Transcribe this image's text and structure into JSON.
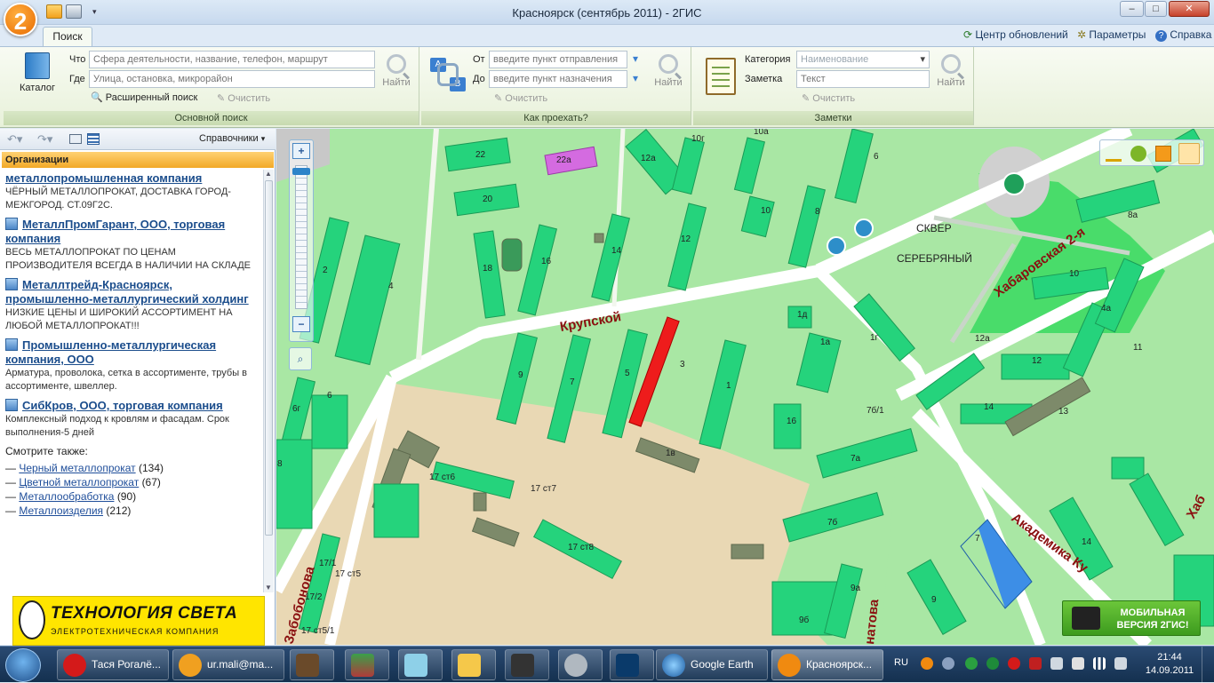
{
  "window": {
    "title": "Красноярск (сентябрь 2011) - 2ГИС",
    "logo_glyph": "2",
    "minimize": "–",
    "maximize": "□",
    "close": "✕"
  },
  "tabs": {
    "search": "Поиск"
  },
  "top_links": {
    "updates": "Центр обновлений",
    "settings": "Параметры",
    "help": "Справка"
  },
  "ribbon": {
    "main": {
      "catalog": "Каталог",
      "what_label": "Что",
      "what_placeholder": "Сфера деятельности, название, телефон, маршрут",
      "where_label": "Где",
      "where_placeholder": "Улица, остановка, микрорайон",
      "find": "Найти",
      "advanced": "Расширенный поиск",
      "clear": "Очистить",
      "title": "Основной поиск"
    },
    "route": {
      "from_label": "От",
      "from_placeholder": "введите пункт отправления",
      "to_label": "До",
      "to_placeholder": "введите пункт назначения",
      "find": "Найти",
      "clear": "Очистить",
      "title": "Как проехать?"
    },
    "notes": {
      "category_label": "Категория",
      "category_value": "Наименование",
      "note_label": "Заметка",
      "note_placeholder": "Текст",
      "find": "Найти",
      "clear": "Очистить",
      "title": "Заметки"
    }
  },
  "panel": {
    "directories": "Справочники",
    "header": "Организации",
    "firms": [
      {
        "name": "металлопромышленная компания",
        "desc": "ЧЁРНЫЙ МЕТАЛЛОПРОКАТ, ДОСТАВКА ГОРОД-МЕЖГОРОД. СТ.09Г2С.",
        "icon": false
      },
      {
        "name": "МеталлПромГарант, ООО, торговая компания",
        "desc": "ВЕСЬ МЕТАЛЛОПРОКАТ ПО ЦЕНАМ ПРОИЗВОДИТЕЛЯ ВСЕГДА В НАЛИЧИИ НА СКЛАДЕ",
        "icon": true
      },
      {
        "name": "Металлтрейд-Красноярск, промышленно-металлургический холдинг",
        "desc": "НИЗКИЕ ЦЕНЫ И ШИРОКИЙ АССОРТИМЕНТ НА ЛЮБОЙ МЕТАЛЛОПРОКАТ!!!",
        "icon": true
      },
      {
        "name": "Промышленно-металлургическая компания, ООО",
        "desc": "Арматура, проволока, сетка в ассортименте, трубы в ассортименте, швеллер.",
        "icon": true
      },
      {
        "name": "СибКров, ООО, торговая компания",
        "desc": "Комплексный подход к кровлям и фасадам. Срок выполнения-5 дней",
        "icon": true
      }
    ],
    "see_also_title": "Смотрите также:",
    "see_also": [
      {
        "label": "Черный металлопрокат",
        "count": "(134)"
      },
      {
        "label": "Цветной металлопрокат",
        "count": "(67)"
      },
      {
        "label": "Металлообработка",
        "count": "(90)"
      },
      {
        "label": "Металлоизделия",
        "count": "(212)"
      }
    ],
    "ad_line1": "ТЕХНОЛОГИЯ СВЕТА",
    "ad_line2": "ЭЛЕКТРОТЕХНИЧЕСКАЯ КОМПАНИЯ"
  },
  "map": {
    "streets": {
      "krupskoy": "Крупской",
      "khabarovskaya": "Хабаровская 2-я",
      "akademika": "Академика Ку",
      "zabobonova": "Забобонова",
      "natova": "натова",
      "khab_edge": "Хаб"
    },
    "park": [
      "СКВЕР",
      "СЕРЕБРЯНЫЙ"
    ],
    "buildings": [
      "22",
      "22а",
      "20",
      "18",
      "16",
      "14",
      "12",
      "10г",
      "10а",
      "12а",
      "10",
      "8",
      "6",
      "2",
      "4",
      "9",
      "7",
      "5",
      "3",
      "1",
      "1д",
      "1а",
      "1г",
      "12а",
      "10",
      "8а",
      "4а",
      "11",
      "12",
      "14",
      "13",
      "7б/1",
      "16",
      "7а",
      "7б",
      "9а",
      "9б",
      "9",
      "14",
      "7",
      "17 ст6",
      "17 ст7",
      "17 ст8",
      "1в",
      "17/1",
      "17 ст5",
      "17/2",
      "17 ст5/1",
      "6",
      "6г",
      "8"
    ],
    "mobile_line1": "МОБИЛЬНАЯ",
    "mobile_line2": "ВЕРСИЯ 2ГИС!"
  },
  "taskbar": {
    "items": [
      "Тася Рогалё...",
      "ur.mali@ma...",
      "Google Earth",
      "Красноярск..."
    ],
    "lang": "RU",
    "time": "21:44",
    "date": "14.09.2011"
  }
}
